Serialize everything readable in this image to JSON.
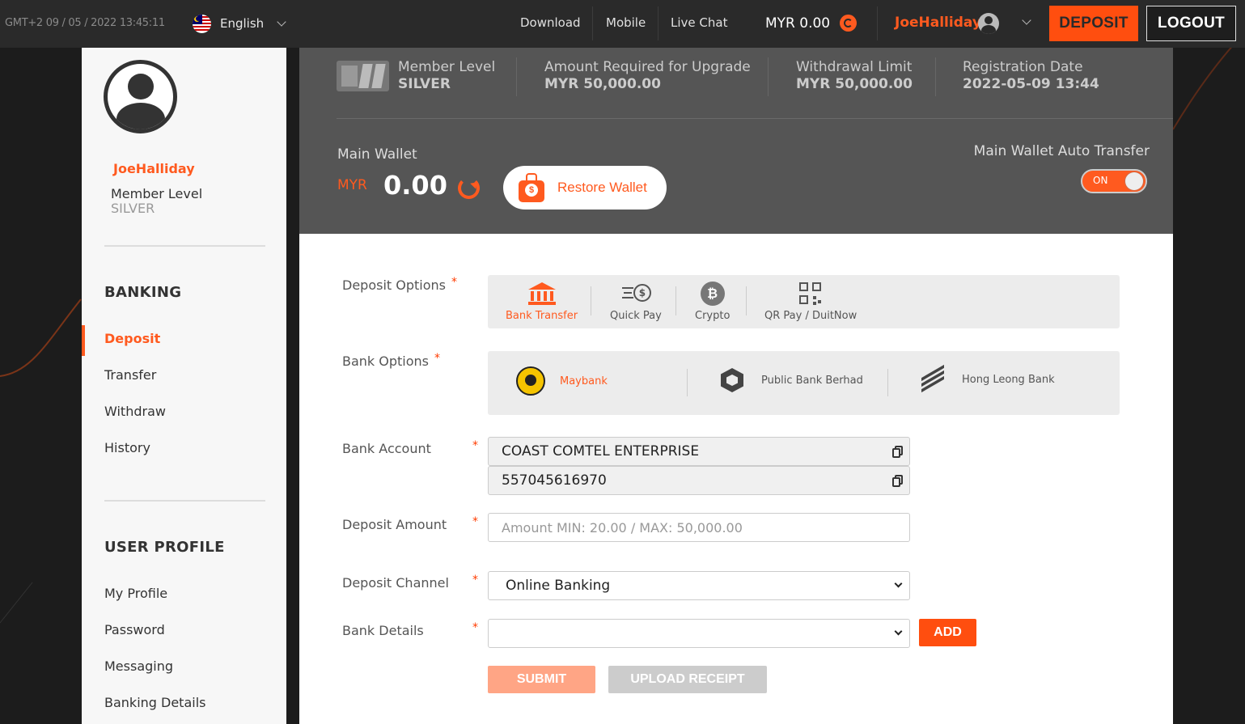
{
  "topbar": {
    "datetime": "GMT+2  09 / 05 / 2022 13:45:11",
    "language": "English",
    "links": [
      "Download",
      "Mobile",
      "Live Chat"
    ],
    "balance": "MYR 0.00",
    "username": "JoeHalliday",
    "deposit_label": "DEPOSIT",
    "logout_label": "LOGOUT"
  },
  "sidebar": {
    "username": "JoeHalliday",
    "member_level_label": "Member Level",
    "member_level_value": "SILVER",
    "banking_heading": "BANKING",
    "banking_items": [
      "Deposit",
      "Transfer",
      "Withdraw",
      "History"
    ],
    "profile_heading": "USER PROFILE",
    "profile_items": [
      "My Profile",
      "Password",
      "Messaging",
      "Banking Details"
    ]
  },
  "info": {
    "member_level_label": "Member Level",
    "member_level_value": "SILVER",
    "upgrade_label": "Amount Required for Upgrade",
    "upgrade_value": "MYR 50,000.00",
    "withdraw_label": "Withdrawal Limit",
    "withdraw_value": "MYR 50,000.00",
    "reg_label": "Registration Date",
    "reg_value": "2022-05-09 13:44"
  },
  "wallet": {
    "label": "Main Wallet",
    "currency": "MYR",
    "amount": "0.00",
    "restore_label": "Restore Wallet",
    "auto_transfer_label": "Main Wallet Auto Transfer",
    "toggle_label": "ON"
  },
  "form": {
    "deposit_options_label": "Deposit Options",
    "deposit_options": [
      "Bank Transfer",
      "Quick Pay",
      "Crypto",
      "QR Pay / DuitNow"
    ],
    "bank_options_label": "Bank Options",
    "bank_options": [
      "Maybank",
      "Public Bank Berhad",
      "Hong Leong Bank"
    ],
    "bank_account_label": "Bank Account",
    "bank_account_name": "COAST COMTEL ENTERPRISE",
    "bank_account_number": "557045616970",
    "deposit_amount_label": "Deposit Amount",
    "deposit_amount_placeholder": "Amount MIN: 20.00 / MAX: 50,000.00",
    "deposit_channel_label": "Deposit Channel",
    "deposit_channel_value": "Online Banking",
    "bank_details_label": "Bank Details",
    "bank_details_value": "",
    "required_mark": "*",
    "add_label": "ADD",
    "submit_label": "SUBMIT",
    "upload_label": "UPLOAD RECEIPT"
  },
  "colors": {
    "accent": "#ff5a1f",
    "topbar_bg": "#2a2a2a",
    "info_bg": "#555555"
  }
}
